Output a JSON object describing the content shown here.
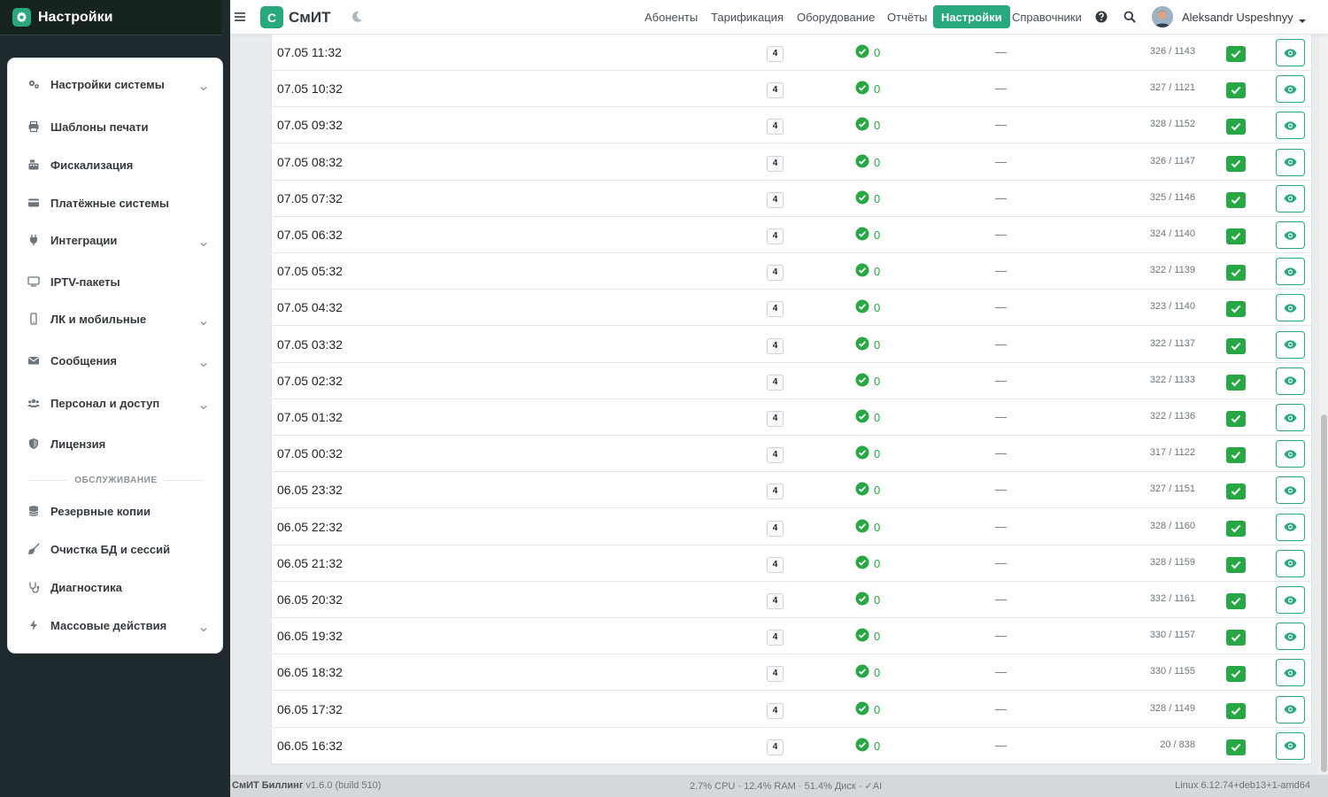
{
  "sidebar": {
    "title": "Настройки",
    "menu": [
      {
        "label": "Настройки системы",
        "icon": "gears-icon",
        "chevron": true
      },
      {
        "label": "Шаблоны печати",
        "icon": "printer-icon",
        "chevron": false
      },
      {
        "label": "Фискализация",
        "icon": "cash-register-icon",
        "chevron": false
      },
      {
        "label": "Платёжные системы",
        "icon": "credit-card-icon",
        "chevron": false
      },
      {
        "label": "Интеграции",
        "icon": "plug-icon",
        "chevron": true
      },
      {
        "label": "IPTV-пакеты",
        "icon": "tv-icon",
        "chevron": false
      },
      {
        "label": "ЛК и мобильные",
        "icon": "mobile-icon",
        "chevron": true
      },
      {
        "label": "Сообщения",
        "icon": "envelope-icon",
        "chevron": true
      },
      {
        "label": "Персонал и доступ",
        "icon": "users-icon",
        "chevron": true
      },
      {
        "label": "Лицензия",
        "icon": "shield-icon",
        "chevron": false
      },
      {
        "label": "Резервные копии",
        "icon": "database-icon",
        "chevron": false
      },
      {
        "label": "Очистка БД и сессий",
        "icon": "broom-icon",
        "chevron": false
      },
      {
        "label": "Диагностика",
        "icon": "stethoscope-icon",
        "chevron": false
      },
      {
        "label": "Массовые действия",
        "icon": "bolt-icon",
        "chevron": true
      }
    ],
    "section_label": "ОБСЛУЖИВАНИЕ"
  },
  "topbar": {
    "logo_letter": "С",
    "app_name": "СмИТ",
    "nav": [
      "Абоненты",
      "Тарификация",
      "Оборудование",
      "Отчёты",
      "Настройки",
      "Справочники"
    ],
    "active_nav": "Настройки",
    "user_name": "Aleksandr Uspeshnyy"
  },
  "rows": [
    {
      "time": "07.05 11:32",
      "count": "4",
      "errors": "0",
      "note": "—",
      "ratio": "326 / 1143"
    },
    {
      "time": "07.05 10:32",
      "count": "4",
      "errors": "0",
      "note": "—",
      "ratio": "327 / 1121"
    },
    {
      "time": "07.05 09:32",
      "count": "4",
      "errors": "0",
      "note": "—",
      "ratio": "328 / 1152"
    },
    {
      "time": "07.05 08:32",
      "count": "4",
      "errors": "0",
      "note": "—",
      "ratio": "326 / 1147"
    },
    {
      "time": "07.05 07:32",
      "count": "4",
      "errors": "0",
      "note": "—",
      "ratio": "325 / 1146"
    },
    {
      "time": "07.05 06:32",
      "count": "4",
      "errors": "0",
      "note": "—",
      "ratio": "324 / 1140"
    },
    {
      "time": "07.05 05:32",
      "count": "4",
      "errors": "0",
      "note": "—",
      "ratio": "322 / 1139"
    },
    {
      "time": "07.05 04:32",
      "count": "4",
      "errors": "0",
      "note": "—",
      "ratio": "323 / 1140"
    },
    {
      "time": "07.05 03:32",
      "count": "4",
      "errors": "0",
      "note": "—",
      "ratio": "322 / 1137"
    },
    {
      "time": "07.05 02:32",
      "count": "4",
      "errors": "0",
      "note": "—",
      "ratio": "322 / 1133"
    },
    {
      "time": "07.05 01:32",
      "count": "4",
      "errors": "0",
      "note": "—",
      "ratio": "322 / 1136"
    },
    {
      "time": "07.05 00:32",
      "count": "4",
      "errors": "0",
      "note": "—",
      "ratio": "317 / 1122"
    },
    {
      "time": "06.05 23:32",
      "count": "4",
      "errors": "0",
      "note": "—",
      "ratio": "327 / 1151"
    },
    {
      "time": "06.05 22:32",
      "count": "4",
      "errors": "0",
      "note": "—",
      "ratio": "328 / 1160"
    },
    {
      "time": "06.05 21:32",
      "count": "4",
      "errors": "0",
      "note": "—",
      "ratio": "328 / 1159"
    },
    {
      "time": "06.05 20:32",
      "count": "4",
      "errors": "0",
      "note": "—",
      "ratio": "332 / 1161"
    },
    {
      "time": "06.05 19:32",
      "count": "4",
      "errors": "0",
      "note": "—",
      "ratio": "330 / 1157"
    },
    {
      "time": "06.05 18:32",
      "count": "4",
      "errors": "0",
      "note": "—",
      "ratio": "330 / 1155"
    },
    {
      "time": "06.05 17:32",
      "count": "4",
      "errors": "0",
      "note": "—",
      "ratio": "328 / 1149"
    },
    {
      "time": "06.05 16:32",
      "count": "4",
      "errors": "0",
      "note": "—",
      "ratio": "20 / 838"
    }
  ],
  "footer": {
    "product": "СмИТ Биллинг",
    "version": "v1.6.0 (build 510)",
    "stats": "2.7% CPU · 12.4% RAM · 51.4% Диск · ✓AI",
    "system": "Linux 6.12.74+deb13+1-amd64"
  },
  "colors": {
    "accent": "#28a87c",
    "success": "#28a745",
    "sidebar_bg": "#1e2a2e"
  }
}
